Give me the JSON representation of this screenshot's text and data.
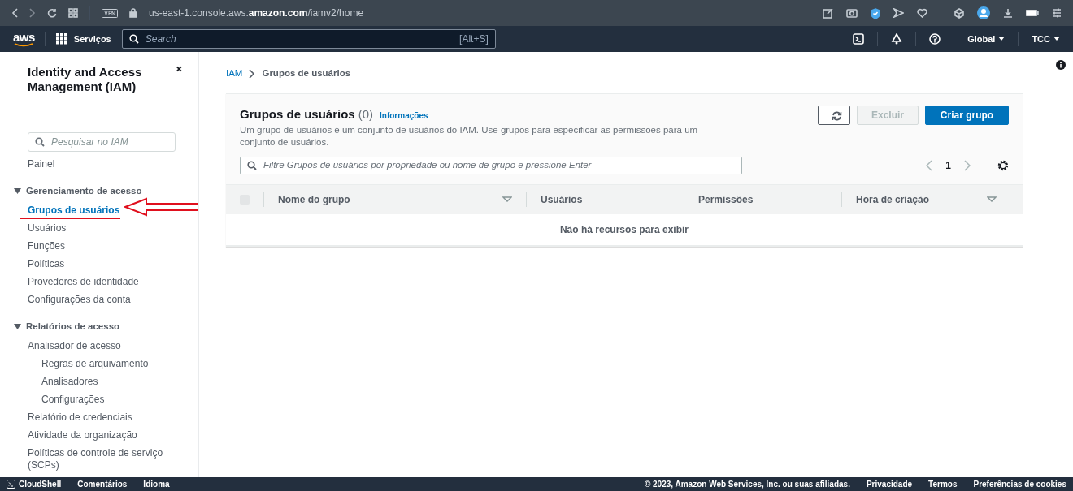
{
  "browser": {
    "url": "us-east-1.console.aws.**amazon.com**/iamv2/home"
  },
  "topnav": {
    "logo": "aws",
    "services": "Serviços",
    "search": {
      "placeholder": "Search",
      "shortcut": "[Alt+S]"
    },
    "region": "Global",
    "account": "TCC"
  },
  "sidebar": {
    "title": "Identity and Access Management (IAM)",
    "search": {
      "placeholder": "Pesquisar no IAM"
    },
    "items": [
      {
        "kind": "link",
        "label": "Painel",
        "selected": false
      },
      {
        "kind": "section",
        "label": "Gerenciamento de acesso",
        "expanded": true,
        "children": [
          {
            "kind": "link",
            "label": "Grupos de usuários",
            "selected": true
          },
          {
            "kind": "link",
            "label": "Usuários",
            "selected": false
          },
          {
            "kind": "link",
            "label": "Funções",
            "selected": false
          },
          {
            "kind": "link",
            "label": "Políticas",
            "selected": false
          },
          {
            "kind": "link",
            "label": "Provedores de identidade",
            "selected": false
          },
          {
            "kind": "link",
            "label": "Configurações da conta",
            "selected": false
          }
        ]
      },
      {
        "kind": "section",
        "label": "Relatórios de acesso",
        "expanded": true,
        "children": [
          {
            "kind": "link",
            "label": "Analisador de acesso",
            "selected": false,
            "children": [
              {
                "kind": "link",
                "label": "Regras de arquivamento",
                "selected": false
              },
              {
                "kind": "link",
                "label": "Analisadores",
                "selected": false
              },
              {
                "kind": "link",
                "label": "Configurações",
                "selected": false
              }
            ]
          },
          {
            "kind": "link",
            "label": "Relatório de credenciais",
            "selected": false
          },
          {
            "kind": "link",
            "label": "Atividade da organização",
            "selected": false
          },
          {
            "kind": "link",
            "label": "Políticas de controle de serviço (SCPs)",
            "selected": false
          }
        ]
      }
    ]
  },
  "breadcrumb": [
    "IAM",
    "Grupos de usuários"
  ],
  "panel": {
    "title": "Grupos de usuários",
    "count": "(0)",
    "info": "Informações",
    "description": "Um grupo de usuários é um conjunto de usuários do IAM. Use grupos para especificar as permissões para um conjunto de usuários.",
    "buttons": [
      {
        "kind": "icon",
        "disabled": false
      },
      {
        "kind": "normal",
        "label": "Excluir",
        "disabled": true
      },
      {
        "kind": "primary",
        "label": "Criar grupo",
        "disabled": false
      }
    ],
    "filter": {
      "placeholder": "Filtre Grupos de usuários por propriedade ou nome de grupo e pressione Enter"
    },
    "page": "1",
    "select_all": {
      "checked": false
    },
    "columns": [
      {
        "label": "Nome do grupo",
        "sortable": true
      },
      {
        "label": "Usuários",
        "sortable": false
      },
      {
        "label": "Permissões",
        "sortable": false
      },
      {
        "label": "Hora de criação",
        "sortable": true
      }
    ],
    "empty": "Não há recursos para exibir"
  },
  "footer": {
    "left": [
      "CloudShell",
      "Comentários",
      "Idioma"
    ],
    "copyright": "© 2023, Amazon Web Services, Inc. ou suas afiliadas.",
    "links": [
      "Privacidade",
      "Termos",
      "Preferências de cookies"
    ]
  }
}
